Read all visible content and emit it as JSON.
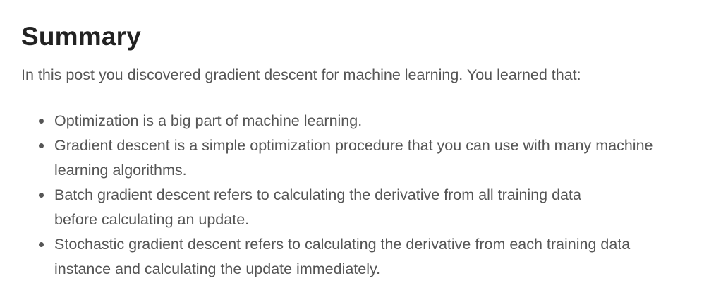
{
  "article": {
    "title": "Summary",
    "intro": "In this post you discovered gradient descent for machine learning. You learned that:",
    "bullets": [
      {
        "lines": [
          "Optimization is a big part of machine learning."
        ]
      },
      {
        "lines": [
          "Gradient descent is a simple optimization procedure that you can use with many machine",
          "learning algorithms."
        ]
      },
      {
        "lines": [
          "Batch gradient descent refers to calculating the derivative from all training data",
          "before calculating an update."
        ]
      },
      {
        "lines": [
          "Stochastic gradient descent refers to calculating the derivative from each training data",
          "instance and calculating the update immediately."
        ]
      }
    ]
  },
  "colors": {
    "heading": "#222222",
    "body_text": "#555555",
    "background": "#ffffff"
  },
  "icons": {
    "bullet": "bullet-dot-icon"
  }
}
